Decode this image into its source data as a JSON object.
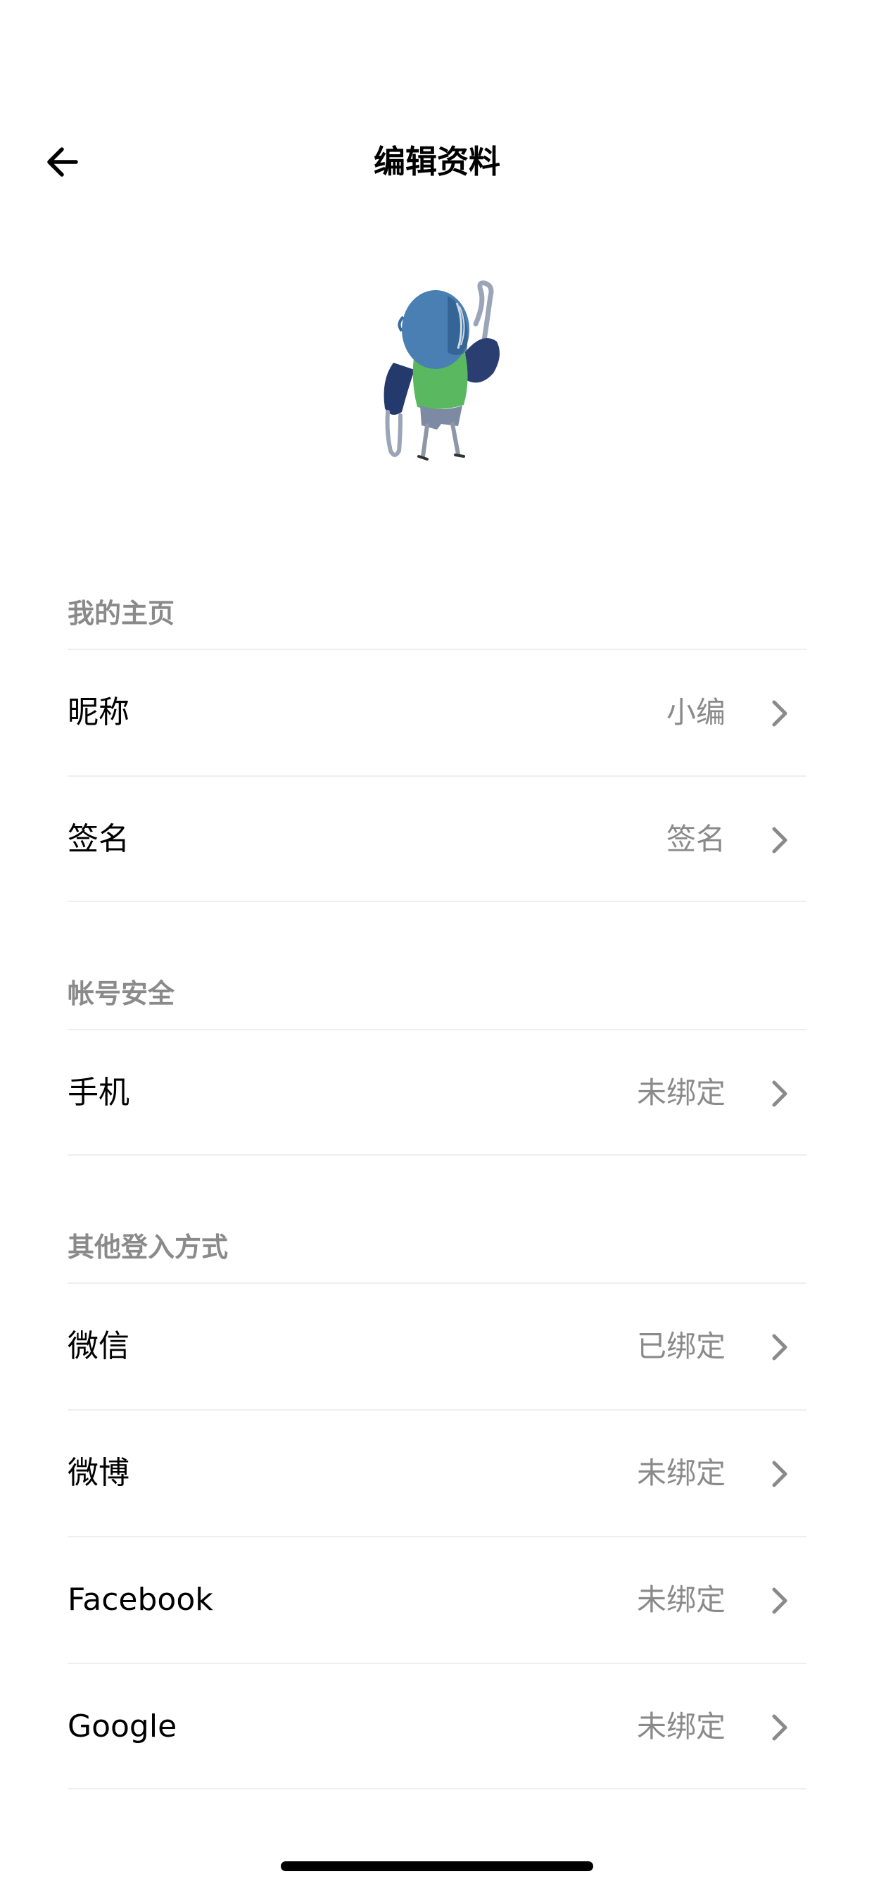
{
  "header": {
    "title": "编辑资料",
    "back_icon": "arrow-left-icon"
  },
  "avatar": {
    "description_icon": "avatar-illustration"
  },
  "sections": {
    "homepage": {
      "title": "我的主页",
      "rows": [
        {
          "label": "昵称",
          "value": "小编"
        },
        {
          "label": "签名",
          "value": "签名"
        }
      ]
    },
    "security": {
      "title": "帐号安全",
      "rows": [
        {
          "label": "手机",
          "value": "未绑定"
        }
      ]
    },
    "other_login": {
      "title": "其他登入方式",
      "rows": [
        {
          "label": "微信",
          "value": "已绑定"
        },
        {
          "label": "微博",
          "value": "未绑定"
        },
        {
          "label": "Facebook",
          "value": "未绑定"
        },
        {
          "label": "Google",
          "value": "未绑定"
        }
      ]
    }
  },
  "colors": {
    "secondary_text": "#8a8a8a",
    "divider": "#efefef",
    "chevron": "#8a8a8a"
  }
}
